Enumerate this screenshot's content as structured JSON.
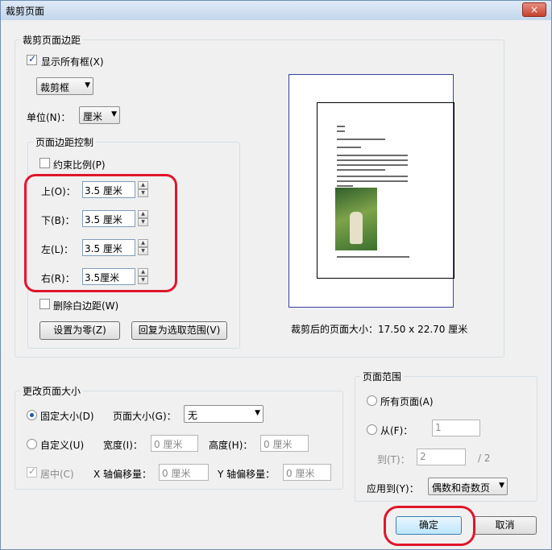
{
  "window": {
    "title": "裁剪页面",
    "close_icon": "×"
  },
  "margins_group": {
    "legend": "裁剪页面边距",
    "show_all_boxes": {
      "label": "显示所有框(X)",
      "checked": true
    },
    "box_select": {
      "value": "裁剪框"
    },
    "unit_label": "单位(N)：",
    "unit_select": {
      "value": "厘米"
    },
    "control_group": {
      "legend": "页面边距控制",
      "constrain": {
        "label": "约束比例(P)",
        "checked": false
      },
      "top": {
        "label": "上(O)：",
        "value": "3.5 厘米"
      },
      "bottom": {
        "label": "下(B)：",
        "value": "3.5 厘米"
      },
      "left": {
        "label": "左(L)：",
        "value": "3.5 厘米"
      },
      "right": {
        "label": "右(R)：",
        "value": "3.5厘米"
      },
      "remove_white": {
        "label": "删除白边距(W)",
        "checked": false
      },
      "set_zero_button": "设置为零(Z)",
      "restore_button": "回复为选取范围(V)"
    },
    "preview_size": "裁剪后的页面大小：17.50 x 22.70 厘米"
  },
  "page_size_group": {
    "legend": "更改页面大小",
    "fixed": {
      "label": "固定大小(D)",
      "selected": true
    },
    "page_size_label": "页面大小(G)：",
    "page_size_select": "无",
    "custom": {
      "label": "自定义(U)",
      "selected": false
    },
    "width_label": "宽度(I)：",
    "width_value": "0 厘米",
    "height_label": "高度(H)：",
    "height_value": "0 厘米",
    "center": {
      "label": "居中(C)",
      "checked": true,
      "disabled": true
    },
    "x_offset_label": "X 轴偏移量：",
    "x_offset_value": "0 厘米",
    "y_offset_label": "Y 轴偏移量：",
    "y_offset_value": "0 厘米"
  },
  "page_range_group": {
    "legend": "页面范围",
    "all_pages": {
      "label": "所有页面(A)",
      "selected": false
    },
    "from": {
      "label": "从(F)：",
      "selected": false,
      "value": "1"
    },
    "to": {
      "label": "到(T)：",
      "value": "2",
      "total": "/ 2"
    },
    "apply_label": "应用到(Y)：",
    "apply_select": "偶数和奇数页"
  },
  "ok_button": "确定",
  "cancel_button": "取消",
  "colors": {
    "highlight_red": "#e0162b",
    "accent_blue": "#3c7fb1"
  }
}
